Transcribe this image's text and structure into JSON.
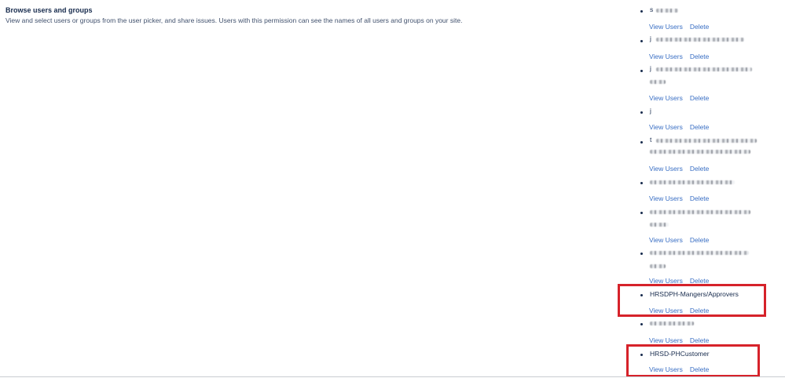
{
  "permission": {
    "title": "Browse users and groups",
    "description": "View and select users or groups from the user picker, and share issues. Users with this permission can see the names of all users and groups on your site."
  },
  "actions": {
    "view_users": "View Users",
    "delete": "Delete"
  },
  "groups": [
    {
      "name": "s",
      "redacted": true
    },
    {
      "name": "j",
      "redacted": true
    },
    {
      "name": "j",
      "redacted": true
    },
    {
      "name": "j",
      "redacted": true
    },
    {
      "name": "t",
      "redacted": true
    },
    {
      "name": "",
      "redacted": true
    },
    {
      "name": "",
      "redacted": true
    },
    {
      "name": "",
      "redacted": true
    },
    {
      "name": "HRSDPH-Mangers/Approvers",
      "redacted": false,
      "highlighted": true
    },
    {
      "name": "",
      "redacted": true
    },
    {
      "name": "HRSD-PHCustomer",
      "redacted": false,
      "highlighted": true
    }
  ],
  "colors": {
    "highlight_border": "#d6222a",
    "link": "#3a6fc4"
  }
}
